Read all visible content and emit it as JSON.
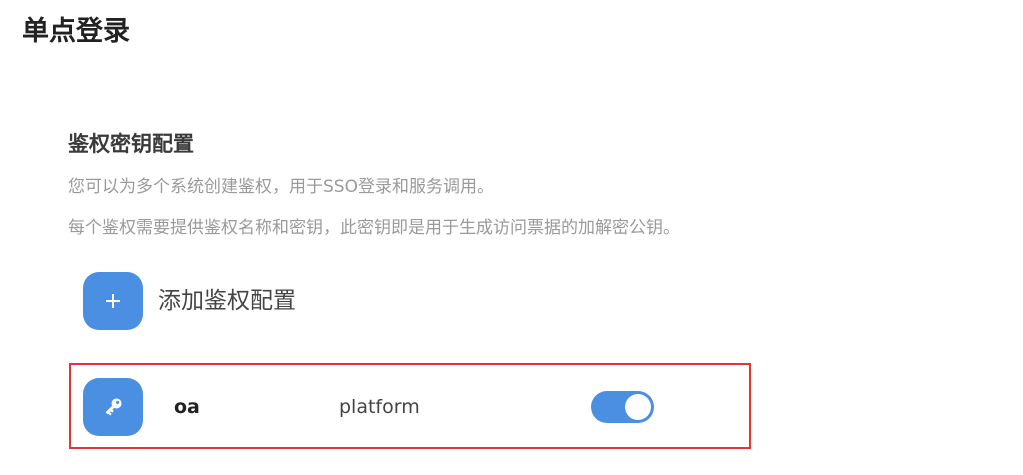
{
  "header": {
    "title": "单点登录"
  },
  "section": {
    "title": "鉴权密钥配置",
    "description_1": "您可以为多个系统创建鉴权，用于SSO登录和服务调用。",
    "description_2": "每个鉴权需要提供鉴权名称和密钥，此密钥即是用于生成访问票据的加解密公钥。"
  },
  "add_button": {
    "icon": "plus-icon",
    "label": "添加鉴权配置"
  },
  "items": [
    {
      "icon": "key-icon",
      "name": "oa",
      "type": "platform",
      "enabled": true
    }
  ],
  "colors": {
    "accent": "#4a8fe2",
    "highlight_border": "#e0363a"
  }
}
